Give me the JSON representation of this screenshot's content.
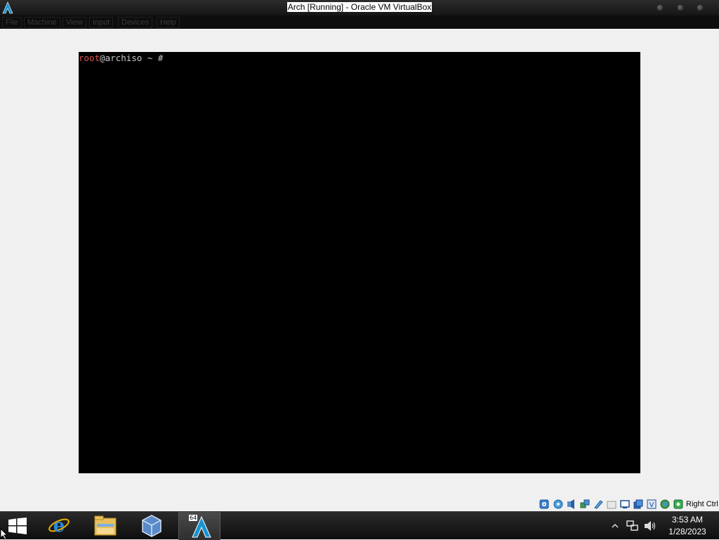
{
  "window": {
    "title": "Arch [Running] - Oracle VM VirtualBox",
    "app_icon": "arch-logo-icon",
    "controls": [
      "minimize-button",
      "maximize-button",
      "close-button"
    ]
  },
  "menubar": {
    "items": [
      {
        "label": "File"
      },
      {
        "label": "Machine"
      },
      {
        "label": "View"
      },
      {
        "label": "Input"
      },
      {
        "label": "Devices"
      },
      {
        "label": "Help"
      }
    ]
  },
  "guest": {
    "prompt_user": "root",
    "prompt_rest": "@archiso ~ #",
    "user_color": "#e05050",
    "text_color": "#c8c8c8",
    "background": "#000000"
  },
  "statusbar": {
    "icons": [
      "hard-disk-icon",
      "optical-drive-icon",
      "audio-icon",
      "network-icon",
      "usb-icon",
      "shared-folders-icon",
      "display-icon",
      "recording-icon",
      "virtualization-icon",
      "mouse-integration-icon",
      "keyboard-icon"
    ],
    "host_key": "Right Ctrl"
  },
  "taskbar": {
    "buttons": [
      "start-button",
      "internet-explorer-icon",
      "file-explorer-icon",
      "virtualbox-icon",
      "arch-vm-icon"
    ],
    "active_badge": "64",
    "tray": {
      "icons": [
        "show-hidden-icons-icon",
        "network-icon",
        "volume-icon"
      ],
      "time": "3:53 AM",
      "date": "1/28/2023"
    }
  }
}
